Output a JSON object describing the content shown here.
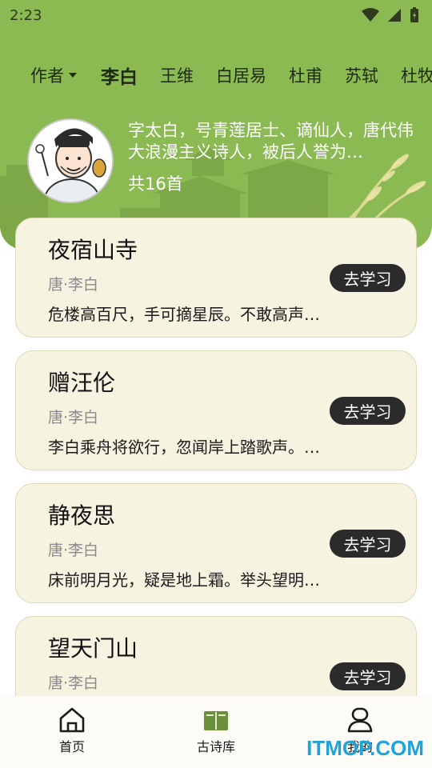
{
  "status_bar": {
    "time": "2:23"
  },
  "tabs": {
    "author_filter": "作者",
    "items": [
      "李白",
      "王维",
      "白居易",
      "杜甫",
      "苏轼",
      "杜牧"
    ],
    "active": "李白"
  },
  "poet": {
    "description": "字太白，号青莲居士、谪仙人，唐代伟大浪漫主义诗人，被后人誉为…",
    "count": "共16首"
  },
  "poems": [
    {
      "title": "夜宿山寺",
      "author": "唐·李白",
      "excerpt": "危楼高百尺，手可摘星辰。不敢高声…",
      "button": "去学习"
    },
    {
      "title": "赠汪伦",
      "author": "唐·李白",
      "excerpt": "李白乘舟将欲行，忽闻岸上踏歌声。…",
      "button": "去学习"
    },
    {
      "title": "静夜思",
      "author": "唐·李白",
      "excerpt": "床前明月光，疑是地上霜。举头望明…",
      "button": "去学习"
    },
    {
      "title": "望天门山",
      "author": "唐·李白",
      "excerpt": "",
      "button": "去学习"
    }
  ],
  "bottom_nav": {
    "home": "首页",
    "library": "古诗库",
    "mine": "我的"
  },
  "watermark": "ITMOP.COM",
  "colors": {
    "header_green": "#8cba52",
    "card_bg": "#f7f3e1",
    "button_dark": "#2b2b2b",
    "library_icon_green": "#6b8f3a",
    "watermark_blue": "#1fa3d9"
  }
}
